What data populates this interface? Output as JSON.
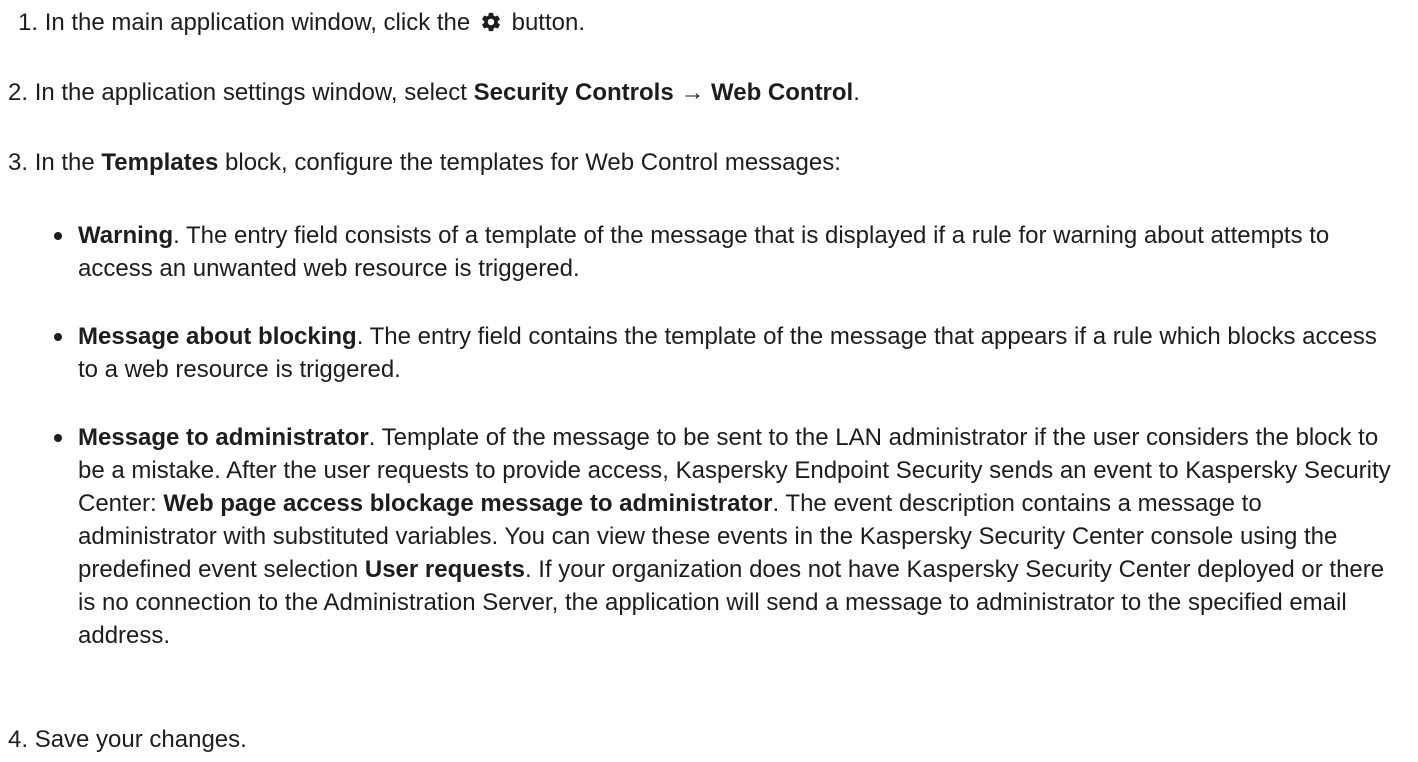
{
  "steps": [
    {
      "num": "1.",
      "before": "In the main application window, click the",
      "icon": "gear-icon",
      "after": "button."
    },
    {
      "num": "2.",
      "before": "In the application settings window, select",
      "bold1": "Security Controls",
      "arrow": "→",
      "bold2": "Web Control",
      "after": "."
    },
    {
      "num": "3.",
      "before": "In the",
      "bold": "Templates",
      "after": "block, configure the templates for Web Control messages:"
    },
    {
      "num": "4.",
      "text": "Save your changes."
    }
  ],
  "bullets": [
    {
      "term": "Warning",
      "text": ". The entry field consists of a template of the message that is displayed if a rule for warning about attempts to access an unwanted web resource is triggered."
    },
    {
      "term": "Message about blocking",
      "text": ". The entry field contains the template of the message that appears if a rule which blocks access to a web resource is triggered."
    },
    {
      "term": "Message to administrator",
      "text_1": ". Template of the message to be sent to the LAN administrator if the user considers the block to be a mistake. After the user requests to provide access, Kaspersky Endpoint Security sends an event to Kaspersky Security Center: ",
      "event_name": "Web page access blockage message to administrator",
      "text_2": ". The event description contains a message to administrator with substituted variables. You can view these events in the Kaspersky Security Center console using the predefined event selection ",
      "selection_name": "User requests",
      "text_3": ". If your organization does not have Kaspersky Security Center deployed or there is no connection to the Administration Server, the application will send a message to administrator to the specified email address."
    }
  ]
}
